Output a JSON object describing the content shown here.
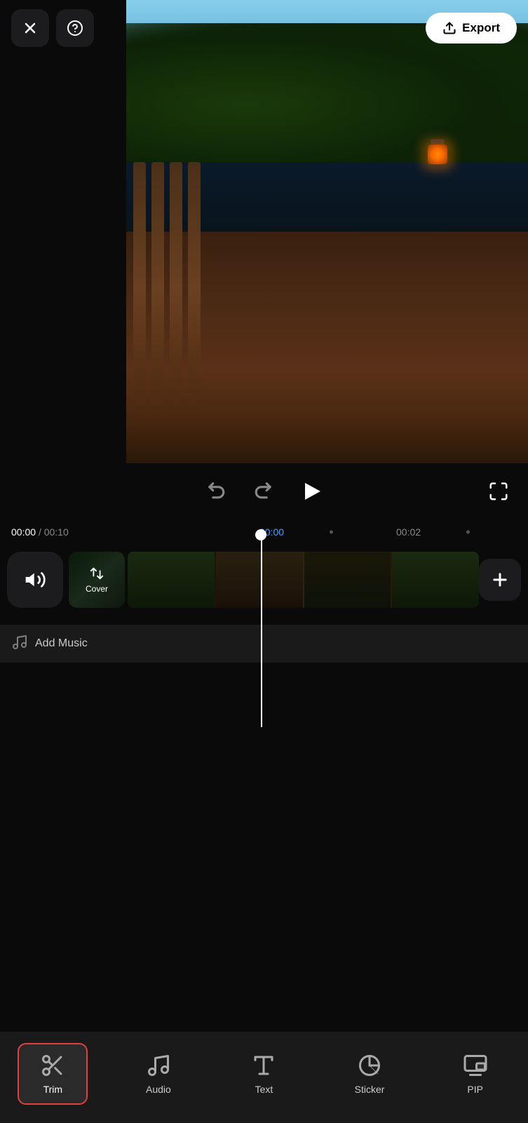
{
  "header": {
    "close_label": "✕",
    "help_label": "?",
    "export_label": "Export"
  },
  "timeline": {
    "current_time": "00:00",
    "total_time": "00:10",
    "separator": "/",
    "marker_start": "00:00",
    "marker_02": "00:02"
  },
  "tracks": {
    "cover_label": "Cover",
    "add_music_label": "Add Music"
  },
  "toolbar": {
    "items": [
      {
        "id": "trim",
        "label": "Trim",
        "active": true
      },
      {
        "id": "audio",
        "label": "Audio",
        "active": false
      },
      {
        "id": "text",
        "label": "Text",
        "active": false
      },
      {
        "id": "sticker",
        "label": "Sticker",
        "active": false
      },
      {
        "id": "pip",
        "label": "PIP",
        "active": false
      }
    ]
  }
}
